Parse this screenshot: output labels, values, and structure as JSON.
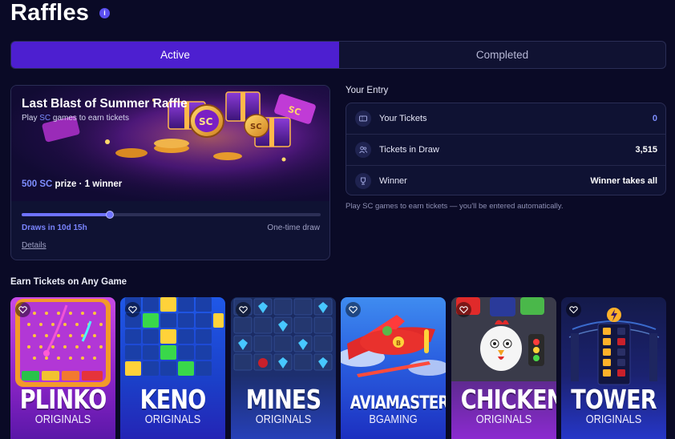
{
  "page": {
    "title": "Raffles"
  },
  "tabs": [
    {
      "label": "Active"
    },
    {
      "label": "Completed"
    }
  ],
  "raffle": {
    "title": "Last Blast of Summer Raffle",
    "subtitle_pre": "Play ",
    "subtitle_sc": "SC",
    "subtitle_post": " games to earn tickets",
    "prize_amount": "500 SC",
    "prize_rest": " prize · 1 winner",
    "progress_fraction": 0.295,
    "draws_in": "Draws in 10d 15h",
    "draw_type": "One-time draw",
    "details_link": "Details"
  },
  "entry": {
    "title": "Your Entry",
    "rows": [
      {
        "label": "Your Tickets",
        "value": "0",
        "icon": "ticket-icon"
      },
      {
        "label": "Tickets in Draw",
        "value": "3,515",
        "icon": "users-icon"
      },
      {
        "label": "Winner",
        "value": "Winner takes all",
        "icon": "trophy-icon"
      }
    ],
    "note": "Play SC games to earn tickets — you'll be entered automatically."
  },
  "earn_title": "Earn Tickets on Any Game",
  "games": [
    {
      "name": "PLINKO",
      "sub": "ORIGINALS"
    },
    {
      "name": "KENO",
      "sub": "ORIGINALS"
    },
    {
      "name": "MINES",
      "sub": "ORIGINALS"
    },
    {
      "name": "AVIAMASTERS",
      "sub": "BGAMING"
    },
    {
      "name": "CHICKEN",
      "sub": "ORIGINALS"
    },
    {
      "name": "TOWER",
      "sub": "ORIGINALS"
    }
  ],
  "colors": {
    "accent": "#4d1fd0",
    "link": "#7e8eff",
    "background": "#0a0a26"
  }
}
